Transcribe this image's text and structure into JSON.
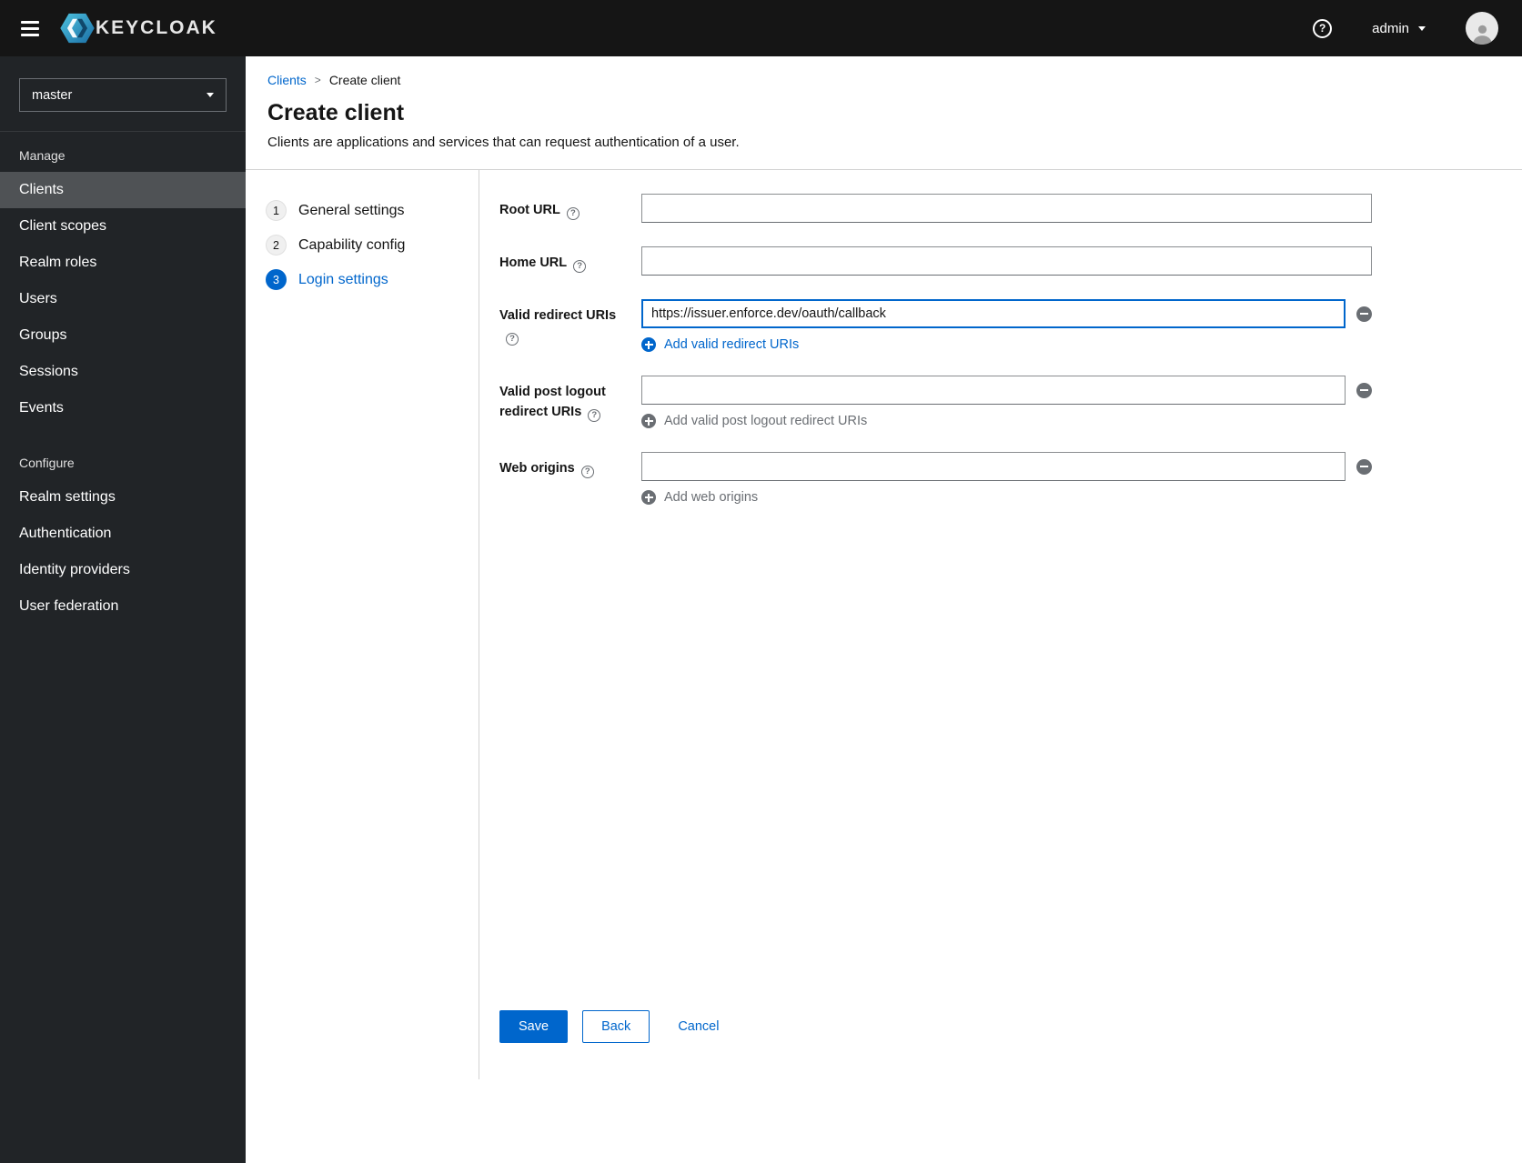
{
  "colors": {
    "accent": "#0066cc",
    "topbar_bg": "#151515",
    "sidebar_bg": "#212427",
    "sidebar_selected_bg": "#4f5255",
    "divider": "#d2d2d2",
    "muted": "#6a6e73"
  },
  "glyphs": {
    "question": "?"
  },
  "topbar": {
    "brand": "KEYCLOAK",
    "user_menu": {
      "label": "admin"
    }
  },
  "sidebar": {
    "realm_selector": {
      "value": "master"
    },
    "sections": [
      {
        "header": "Manage",
        "items": [
          {
            "label": "Clients",
            "selected": true
          },
          {
            "label": "Client scopes",
            "selected": false
          },
          {
            "label": "Realm roles",
            "selected": false
          },
          {
            "label": "Users",
            "selected": false
          },
          {
            "label": "Groups",
            "selected": false
          },
          {
            "label": "Sessions",
            "selected": false
          },
          {
            "label": "Events",
            "selected": false
          }
        ]
      },
      {
        "header": "Configure",
        "items": [
          {
            "label": "Realm settings",
            "selected": false
          },
          {
            "label": "Authentication",
            "selected": false
          },
          {
            "label": "Identity providers",
            "selected": false
          },
          {
            "label": "User federation",
            "selected": false
          }
        ]
      }
    ]
  },
  "breadcrumb": {
    "parent": "Clients",
    "separator": ">",
    "current": "Create client"
  },
  "page": {
    "title": "Create client",
    "subtitle": "Clients are applications and services that can request authentication of a user."
  },
  "wizard": {
    "active_step": "3",
    "steps": [
      {
        "number": "1",
        "label": "General settings"
      },
      {
        "number": "2",
        "label": "Capability config"
      },
      {
        "number": "3",
        "label": "Login settings"
      }
    ]
  },
  "form": {
    "root_url": {
      "label": "Root URL",
      "value": ""
    },
    "home_url": {
      "label": "Home URL",
      "value": ""
    },
    "valid_redirect_uris": {
      "label": "Valid redirect URIs",
      "value": "https://issuer.enforce.dev/oauth/callback",
      "add_label": "Add valid redirect URIs"
    },
    "post_logout_redirect_uris": {
      "label": "Valid post logout redirect URIs",
      "value": "",
      "add_label": "Add valid post logout redirect URIs"
    },
    "web_origins": {
      "label": "Web origins",
      "value": "",
      "add_label": "Add web origins"
    }
  },
  "actions": {
    "save": "Save",
    "back": "Back",
    "cancel": "Cancel"
  }
}
